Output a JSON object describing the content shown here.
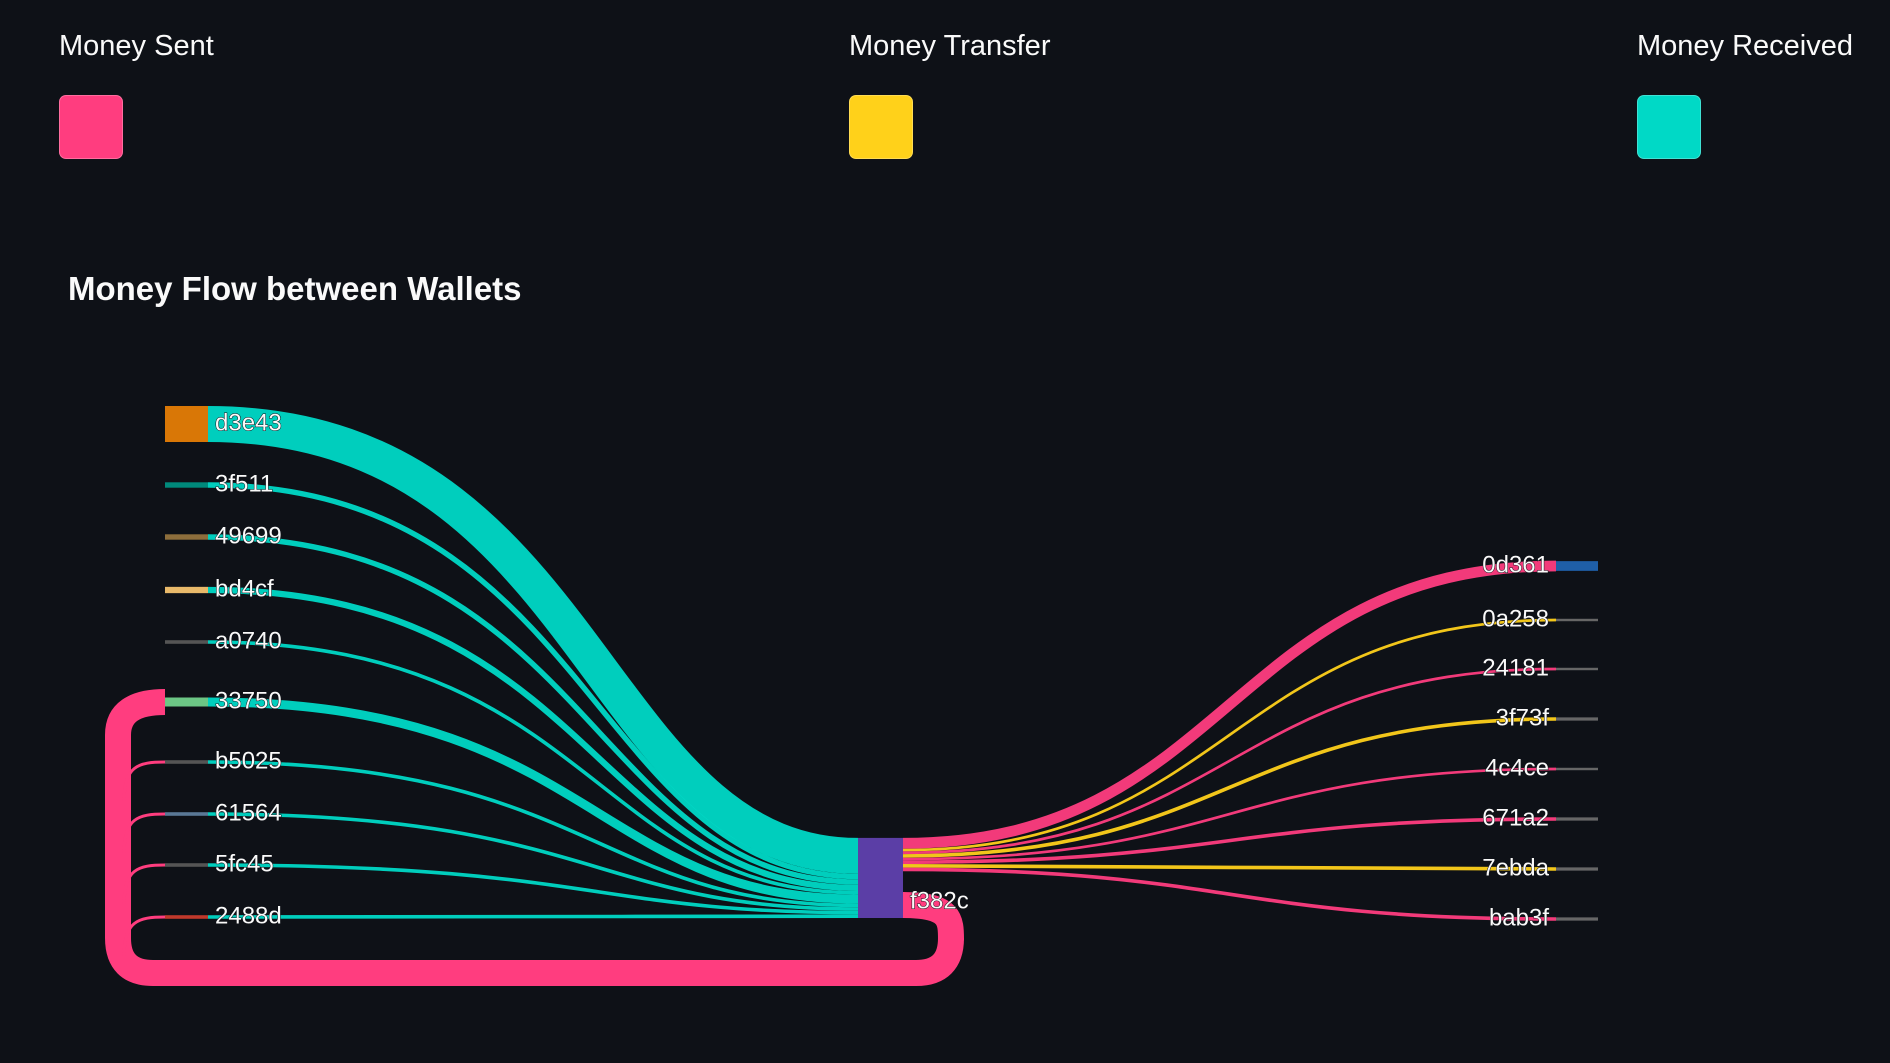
{
  "legend": {
    "sent": {
      "label": "Money Sent",
      "color": "#ff3d7f"
    },
    "transfer": {
      "label": "Money Transfer",
      "color": "#ffd11a"
    },
    "received": {
      "label": "Money Received",
      "color": "#00d9c6"
    }
  },
  "chart_data": {
    "type": "sankey",
    "title": "Money Flow between Wallets",
    "hub": {
      "name": "f382c",
      "color": "#5b3ea6"
    },
    "sources": [
      {
        "name": "d3e43",
        "value": 20,
        "color": "#d97706"
      },
      {
        "name": "3f511",
        "value": 3,
        "color": "#00897b"
      },
      {
        "name": "49699",
        "value": 3,
        "color": "#8d6e3c"
      },
      {
        "name": "bd4cf",
        "value": 3.5,
        "color": "#e8b96a"
      },
      {
        "name": "a0740",
        "value": 2,
        "color": "#555555"
      },
      {
        "name": "33750",
        "value": 5,
        "color": "#6cc685"
      },
      {
        "name": "b5025",
        "value": 2,
        "color": "#555555"
      },
      {
        "name": "61564",
        "value": 2,
        "color": "#5a7896"
      },
      {
        "name": "5fc45",
        "value": 2,
        "color": "#555555"
      },
      {
        "name": "2488d",
        "value": 2,
        "color": "#c0392b"
      }
    ],
    "targets": [
      {
        "name": "0d361",
        "value": 6,
        "flow": "sent",
        "color": "#1f5fa8"
      },
      {
        "name": "0a258",
        "value": 1.5,
        "flow": "transfer",
        "color": "#666666"
      },
      {
        "name": "24181",
        "value": 1.5,
        "flow": "sent",
        "color": "#666666"
      },
      {
        "name": "3f73f",
        "value": 2,
        "flow": "transfer",
        "color": "#666666"
      },
      {
        "name": "4c4ce",
        "value": 1.5,
        "flow": "sent",
        "color": "#666666"
      },
      {
        "name": "671a2",
        "value": 2,
        "flow": "sent",
        "color": "#666666"
      },
      {
        "name": "7ebda",
        "value": 2,
        "flow": "transfer",
        "color": "#666666"
      },
      {
        "name": "bab3f",
        "value": 2,
        "flow": "sent",
        "color": "#666666"
      }
    ],
    "loop": {
      "from": "f382c",
      "to": [
        "b5025",
        "61564",
        "5fc45",
        "2488d"
      ],
      "flow": "sent"
    }
  }
}
